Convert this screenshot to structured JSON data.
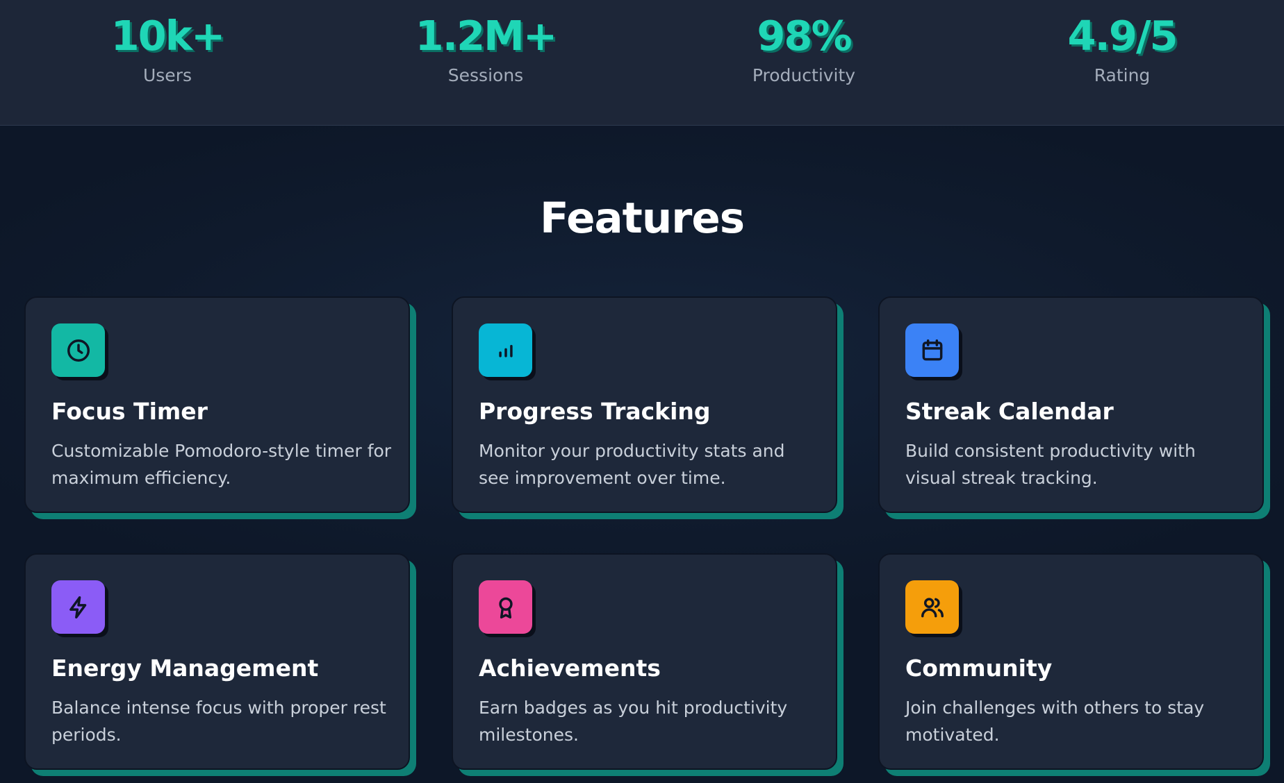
{
  "stats": [
    {
      "value": "10k+",
      "label": "Users"
    },
    {
      "value": "1.2M+",
      "label": "Sessions"
    },
    {
      "value": "98%",
      "label": "Productivity"
    },
    {
      "value": "4.9/5",
      "label": "Rating"
    }
  ],
  "features": {
    "title": "Features",
    "cards": [
      {
        "icon": "clock-icon",
        "color": "#13b8a4",
        "title": "Focus Timer",
        "description": "Customizable Pomodoro-style timer for maximum efficiency."
      },
      {
        "icon": "bar-chart-icon",
        "color": "#07b6d5",
        "title": "Progress Tracking",
        "description": "Monitor your productivity stats and see improvement over time."
      },
      {
        "icon": "calendar-icon",
        "color": "#3b82f6",
        "title": "Streak Calendar",
        "description": "Build consistent productivity with visual streak tracking."
      },
      {
        "icon": "lightning-icon",
        "color": "#8b5cf6",
        "title": "Energy Management",
        "description": "Balance intense focus with proper rest periods."
      },
      {
        "icon": "award-icon",
        "color": "#ec4899",
        "title": "Achievements",
        "description": "Earn badges as you hit productivity milestones."
      },
      {
        "icon": "users-icon",
        "color": "#f59e0b",
        "title": "Community",
        "description": "Join challenges with others to stay motivated."
      }
    ]
  }
}
